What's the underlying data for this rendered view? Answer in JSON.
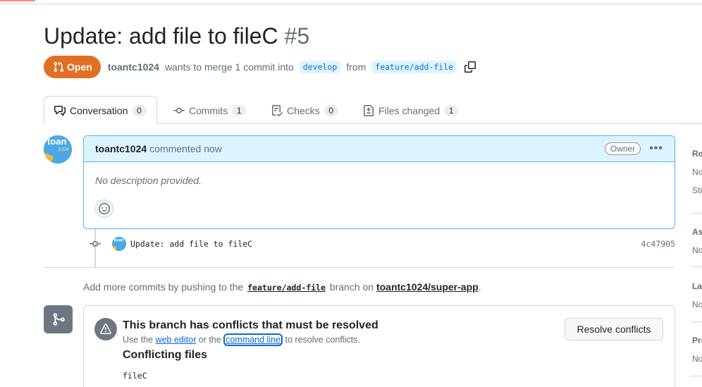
{
  "pr": {
    "title": "Update: add file to fileC",
    "number": "#5",
    "state": "Open",
    "author": "toantc1024",
    "merge_text": "wants to merge 1 commit into",
    "base_branch": "develop",
    "from_text": "from",
    "head_branch": "feature/add-file"
  },
  "tabs": [
    {
      "label": "Conversation",
      "count": "0"
    },
    {
      "label": "Commits",
      "count": "1"
    },
    {
      "label": "Checks",
      "count": "0"
    },
    {
      "label": "Files changed",
      "count": "1"
    }
  ],
  "comment": {
    "author": "toantc1024",
    "time": "commented now",
    "badge": "Owner",
    "body": "No description provided."
  },
  "avatar_text": {
    "line1": "toan",
    "line2": "1024"
  },
  "commit": {
    "message": "Update: add file to fileC",
    "sha": "4c47905"
  },
  "add_more": {
    "prefix": "Add more commits by pushing to the",
    "branch": "feature/add-file",
    "middle": "branch on",
    "repo": "toantc1024/super-app",
    "suffix": "."
  },
  "conflicts": {
    "title": "This branch has conflicts that must be resolved",
    "use_the": "Use the",
    "web_editor": "web editor",
    "or_the": "or the",
    "command_line": "command line",
    "to_resolve": "to resolve conflicts.",
    "files_heading": "Conflicting files",
    "files": [
      "fileC"
    ],
    "button": "Resolve conflicts"
  },
  "sidebar": [
    {
      "heading": "Re",
      "values": [
        "No",
        "Sti"
      ]
    },
    {
      "heading": "Ass",
      "values": [
        "No"
      ]
    },
    {
      "heading": "Lab",
      "values": [
        "No"
      ]
    },
    {
      "heading": "Pro",
      "values": [
        "No"
      ]
    }
  ],
  "colors": {
    "open_state": "#e16f24",
    "link": "#0969da",
    "comment_header": "#ddf4ff",
    "comment_border": "#54aeff"
  }
}
